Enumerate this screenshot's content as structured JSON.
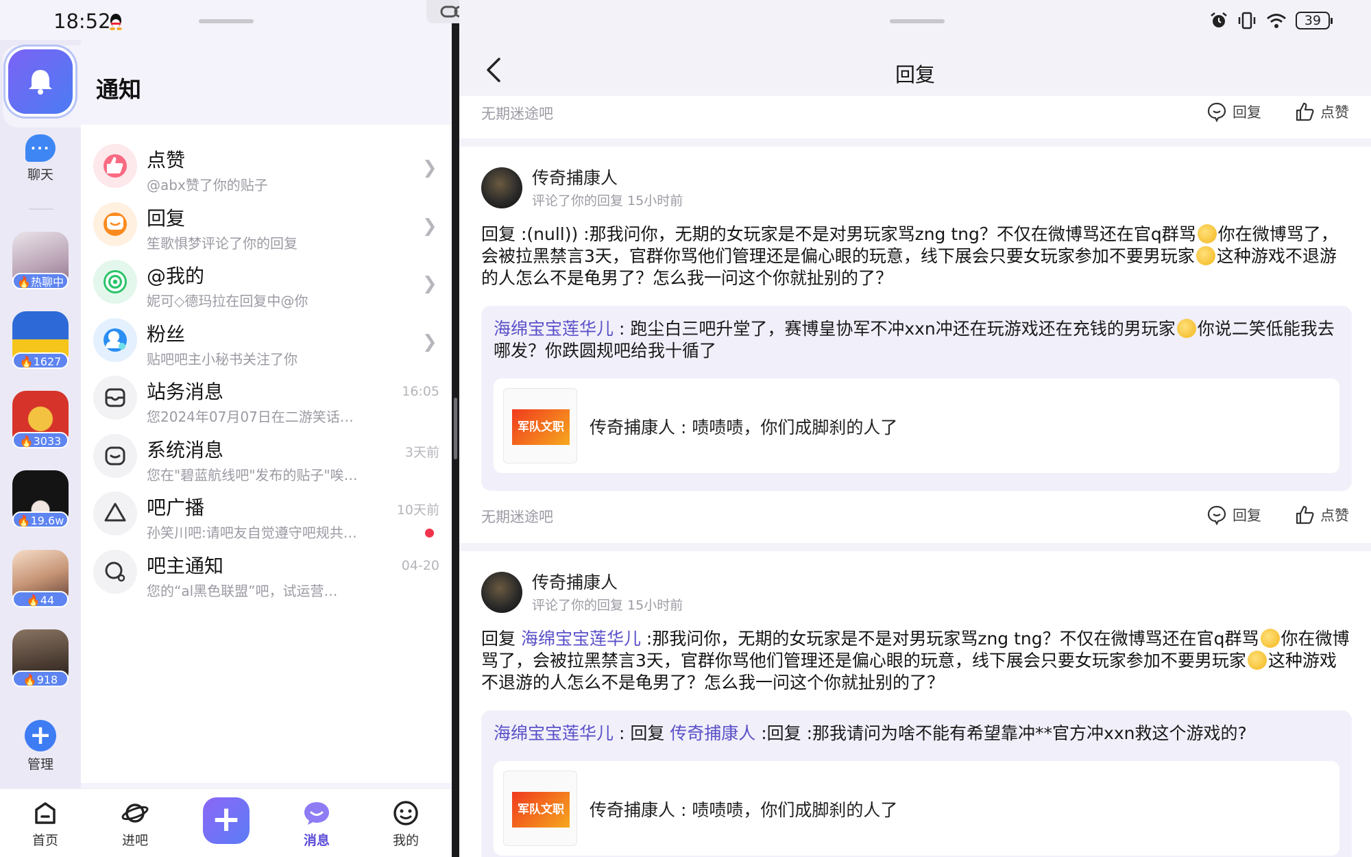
{
  "status": {
    "time": "18:52",
    "battery": "39"
  },
  "rail": {
    "chat_label": "聊天",
    "forums": [
      {
        "heat": "热聊中",
        "color": "#c9b7c6"
      },
      {
        "heat": "1627",
        "color": "#f6c51b"
      },
      {
        "heat": "3033",
        "color": "#d6332a"
      },
      {
        "heat": "19.6w",
        "color": "#141414"
      },
      {
        "heat": "44",
        "color": "#e7bfa3"
      },
      {
        "heat": "918",
        "color": "#5b4a3a"
      }
    ],
    "manage_label": "管理"
  },
  "page_title": "通知",
  "notifications": [
    {
      "title": "点赞",
      "sub": "@abx赞了你的贴子",
      "time": "",
      "color": "#f96b82",
      "bg": "#fde8ec",
      "icon": "thumbs-up-icon"
    },
    {
      "title": "回复",
      "sub": "笙歌惧梦评论了你的回复",
      "time": "",
      "color": "#fb8a1e",
      "bg": "#fff0e0",
      "icon": "reply-icon"
    },
    {
      "title": "@我的",
      "sub": "妮可◇德玛拉在回复中@你",
      "time": "",
      "color": "#2bc46a",
      "bg": "#e3f7ec",
      "icon": "at-icon"
    },
    {
      "title": "粉丝",
      "sub": "贴吧吧主小秘书关注了你",
      "time": "",
      "color": "#2a8ef3",
      "bg": "#e4f0fd",
      "icon": "fans-icon"
    },
    {
      "title": "站务消息",
      "sub": "您2024年07月07日在二游笑话…",
      "time": "16:05",
      "color": "#444444",
      "bg": "#f2f2f5",
      "icon": "inbox-icon"
    },
    {
      "title": "系统消息",
      "sub": "您在\"碧蓝航线吧\"发布的贴子\"唉…",
      "time": "3天前",
      "color": "#444444",
      "bg": "#f2f2f5",
      "icon": "system-icon"
    },
    {
      "title": "吧广播",
      "sub": "孙笑川吧:请吧友自觉遵守吧规共…",
      "time": "10天前",
      "color": "#444444",
      "bg": "#f2f2f5",
      "icon": "broadcast-icon"
    },
    {
      "title": "吧主通知",
      "sub": "您的“al黑色联盟”吧，试运营…",
      "time": "04-20",
      "color": "#444444",
      "bg": "#f2f2f5",
      "icon": "owner-notice-icon"
    }
  ],
  "bottom_nav": [
    {
      "label": "首页",
      "icon": "home-icon"
    },
    {
      "label": "进吧",
      "icon": "planet-icon"
    },
    {
      "label": "消息",
      "icon": "message-icon"
    },
    {
      "label": "我的",
      "icon": "profile-icon"
    }
  ],
  "detail": {
    "title": "回复",
    "top_forum": "无期迷途吧",
    "reply_label": "回复",
    "like_label": "点赞",
    "posts": [
      {
        "author": "传奇捕康人",
        "meta": "评论了你的回复  15小时前",
        "body_pre": "回复 :(null)) :那我问你，无期的女玩家是不是对男玩家骂zng tng？不仅在微博骂还在官q群骂",
        "body_mid": "你在微博骂了，会被拉黑禁言3天，官群你骂他们管理还是偏心眼的玩意，线下展会只要女玩家参加不要男玩家",
        "body_post": "这种游戏不退游的人怎么不是龟男了？怎么我一问这个你就扯别的了？",
        "quote_user": "海绵宝宝莲华儿",
        "quote_text": " : 跑尘白三吧升堂了，赛博皇协军不冲xxn冲还在玩游戏还在充钱的男玩家",
        "quote_text2": "你说二笑低能我去哪发？你跌圆规吧给我十循了",
        "thumb_label": "军队文职",
        "inner": "传奇捕康人 : 啧啧啧，你们成脚刹的人了",
        "forum": "无期迷途吧"
      },
      {
        "author": "传奇捕康人",
        "meta": "评论了你的回复  15小时前",
        "body_reply": "回复 ",
        "body_mention": "海绵宝宝莲华儿",
        "body_pre": " :那我问你，无期的女玩家是不是对男玩家骂zng tng？不仅在微博骂还在官q群骂",
        "body_mid": "你在微博骂了，会被拉黑禁言3天，官群你骂他们管理还是偏心眼的玩意，线下展会只要女玩家参加不要男玩家",
        "body_post": "这种游戏不退游的人怎么不是龟男了？怎么我一问这个你就扯别的了？",
        "quote_user": "海绵宝宝莲华儿",
        "quote_mid": " : 回复 ",
        "quote_mention": "传奇捕康人",
        "quote_text": " :回复 :那我请问为啥不能有希望靠冲**官方冲xxn救这个游戏的?",
        "thumb_label": "军队文职",
        "inner": "传奇捕康人 : 啧啧啧，你们成脚刹的人了"
      }
    ]
  }
}
